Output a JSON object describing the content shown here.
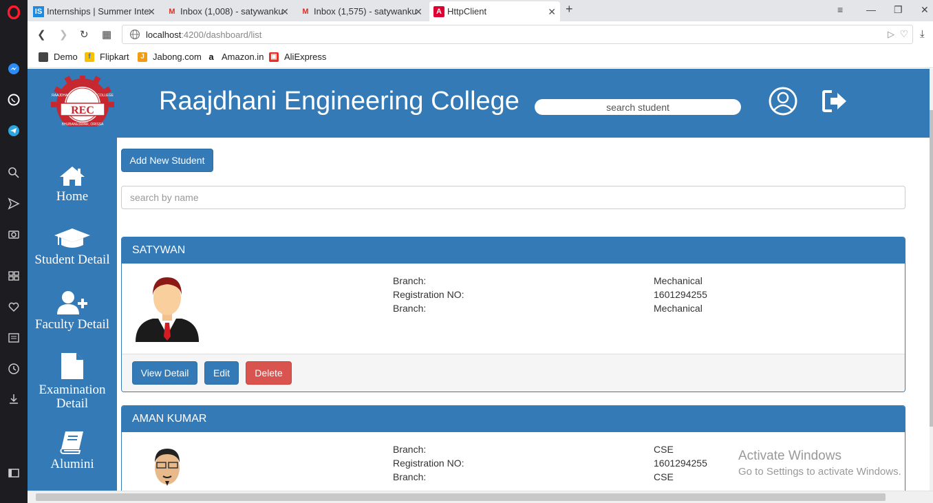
{
  "browser": {
    "tabs": [
      {
        "title": "Internships | Summer Inter",
        "favicon": "IS"
      },
      {
        "title": "Inbox (1,008) - satywankur",
        "favicon": "M"
      },
      {
        "title": "Inbox (1,575) - satywankur",
        "favicon": "M"
      },
      {
        "title": "HttpClient",
        "favicon": "A"
      }
    ],
    "url_host": "localhost",
    "url_path": ":4200/dashboard/list",
    "bookmarks": [
      "Demo",
      "Flipkart",
      "Jabong.com",
      "Amazon.in",
      "AliExpress"
    ]
  },
  "header": {
    "logo_text": "REC",
    "logo_ring_top": "RAAJDHANI ENGINEERING COLLEGE",
    "logo_ring_bottom": "BHUBANESWAR, ORISSA",
    "title": "Raajdhani Engineering College",
    "search_placeholder": "search student"
  },
  "sidebar": {
    "items": [
      {
        "label": "Home",
        "icon": "home-icon"
      },
      {
        "label": "Student Detail",
        "icon": "graduation-cap-icon"
      },
      {
        "label": "Faculty Detail",
        "icon": "user-plus-icon"
      },
      {
        "label": "Examination",
        "label2": "Detail",
        "icon": "file-icon"
      },
      {
        "label": "Alumini",
        "icon": "book-icon"
      }
    ]
  },
  "main": {
    "add_button": "Add New Student",
    "search_placeholder": "search by name",
    "students": [
      {
        "name": "SATYWAN",
        "fields": [
          {
            "label": "Branch:",
            "value": "Mechanical"
          },
          {
            "label": "Registration NO:",
            "value": "1601294255"
          },
          {
            "label": "Branch:",
            "value": "Mechanical"
          }
        ],
        "actions": {
          "view": "View Detail",
          "edit": "Edit",
          "delete": "Delete"
        }
      },
      {
        "name": "AMAN KUMAR",
        "fields": [
          {
            "label": "Branch:",
            "value": "CSE"
          },
          {
            "label": "Registration NO:",
            "value": "1601294255"
          },
          {
            "label": "Branch:",
            "value": "CSE"
          }
        ]
      }
    ]
  },
  "watermark": {
    "line1": "Activate Windows",
    "line2": "Go to Settings to activate Windows."
  },
  "colors": {
    "primary": "#337ab7",
    "danger": "#d9534f",
    "opera_sidebar": "#1c1c21"
  }
}
